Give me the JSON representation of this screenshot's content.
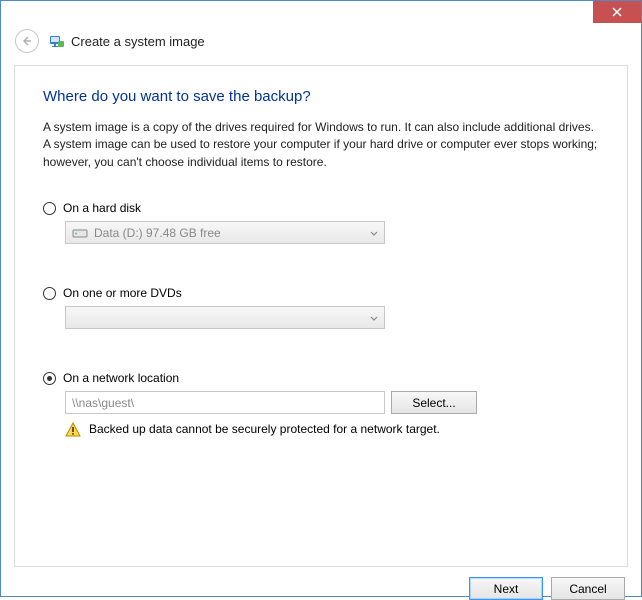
{
  "window": {
    "title": "Create a system image"
  },
  "main": {
    "heading": "Where do you want to save the backup?",
    "description": "A system image is a copy of the drives required for Windows to run. It can also include additional drives. A system image can be used to restore your computer if your hard drive or computer ever stops working; however, you can't choose individual items to restore.",
    "option_hard_disk": {
      "label": "On a hard disk",
      "selected_drive": "Data (D:)  97.48 GB free"
    },
    "option_dvd": {
      "label": "On one or more DVDs"
    },
    "option_network": {
      "label": "On a network location",
      "path": "\\\\nas\\guest\\",
      "select_button": "Select...",
      "warning": "Backed up data cannot be securely protected for a network target."
    }
  },
  "footer": {
    "next": "Next",
    "cancel": "Cancel"
  }
}
